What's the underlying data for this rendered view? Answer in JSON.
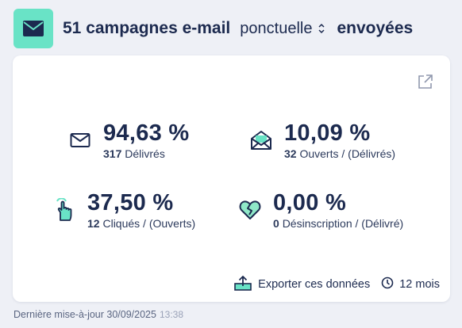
{
  "header": {
    "title": "51 campagnes e-mail",
    "type_select": "ponctuelle",
    "suffix": "envoyées"
  },
  "stats": [
    {
      "value": "94,63 %",
      "count": "317",
      "label": "Délivrés"
    },
    {
      "value": "10,09 %",
      "count": "32",
      "label": "Ouverts / (Délivrés)"
    },
    {
      "value": "37,50 %",
      "count": "12",
      "label": "Cliqués / (Ouverts)"
    },
    {
      "value": "0,00 %",
      "count": "0",
      "label": "Désinscription / (Délivré)"
    }
  ],
  "footer": {
    "export_label": "Exporter ces données",
    "period_label": "12 mois"
  },
  "updated": {
    "label": "Dernière mise-à-jour 30/09/2025",
    "time": "13:38"
  },
  "colors": {
    "accent": "#69e3c6",
    "text": "#1c2a4f",
    "background": "#eef0f6"
  },
  "icons": [
    "mail-icon",
    "chevron-updown-icon",
    "external-link-icon",
    "envelope-icon",
    "open-envelope-icon",
    "pointer-hand-icon",
    "broken-heart-icon",
    "export-icon",
    "clock-icon"
  ]
}
